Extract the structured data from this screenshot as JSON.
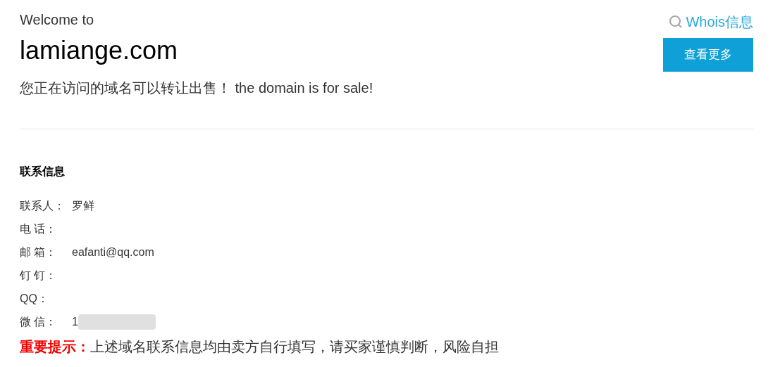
{
  "header": {
    "welcome": "Welcome to",
    "domain": "lamiange.com",
    "sale_text": "您正在访问的域名可以转让出售！ the domain is for sale!"
  },
  "whois_link": "Whois信息",
  "more_button": "查看更多",
  "contact": {
    "title": "联系信息",
    "rows": [
      {
        "label": "联系人：",
        "value": "罗鲜",
        "redacted": false
      },
      {
        "label": "电 话：",
        "redacted": false
      },
      {
        "label": "邮 箱：",
        "value": "eafanti@qq.com",
        "redacted": false
      },
      {
        "label": "钉 钉：",
        "redacted": false
      },
      {
        "label": "QQ：",
        "redacted": false
      },
      {
        "label": "微 信：",
        "value": "1",
        "redacted": true
      }
    ]
  },
  "notice": {
    "label": "重要提示：",
    "text": "上述域名联系信息均由卖方自行填写，请买家谨慎判断，风险自担"
  }
}
